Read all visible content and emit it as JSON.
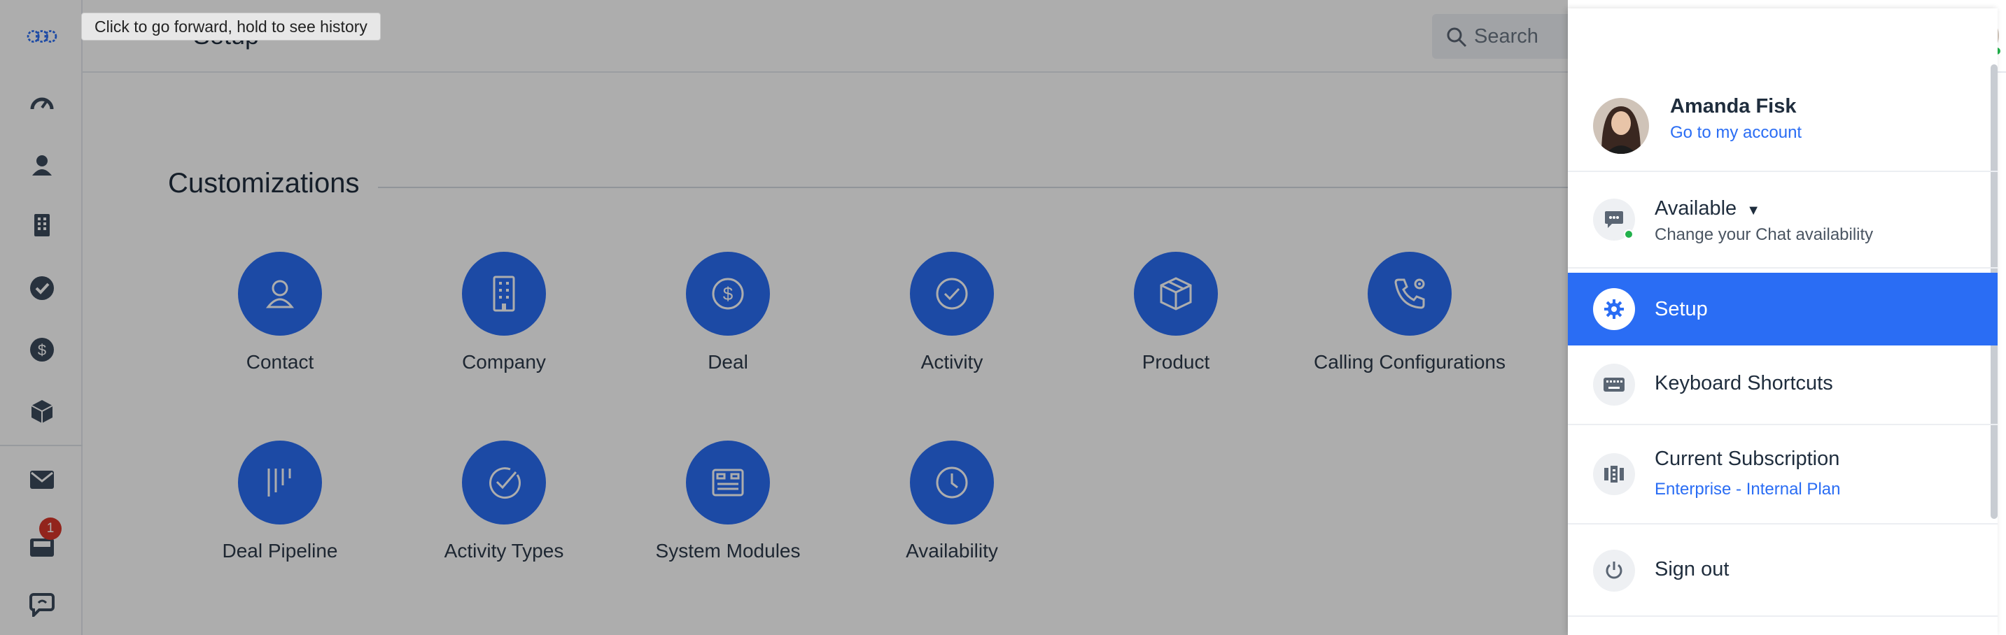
{
  "tooltip": "Click to go forward, hold to see history",
  "header": {
    "title": "Setup",
    "search_placeholder": "Search"
  },
  "sidebar": {
    "notification_count": "1"
  },
  "customizations": {
    "title": "Customizations",
    "row1": [
      "Contact",
      "Company",
      "Deal",
      "Activity",
      "Product",
      "Calling Configurations"
    ],
    "row2": [
      "Deal Pipeline",
      "Activity Types",
      "System Modules",
      "Availability"
    ]
  },
  "menu": {
    "user_name": "Amanda Fisk",
    "account_link": "Go to my account",
    "availability": {
      "status": "Available",
      "caption": "Change your Chat availability"
    },
    "setup": "Setup",
    "shortcuts": "Keyboard Shortcuts",
    "subscription": {
      "title": "Current Subscription",
      "plan": "Enterprise - Internal Plan"
    },
    "sign_out": "Sign out"
  },
  "colors": {
    "accent": "#2a6df4",
    "online": "#22b14c",
    "badge": "#d8352a",
    "arrow": "#e8402a"
  },
  "icons": {
    "sidebar": [
      "logo-icon",
      "dashboard-icon",
      "contact-icon",
      "company-icon",
      "activity-icon",
      "deal-icon",
      "product-icon",
      "mail-icon",
      "inbox-icon",
      "chat-icon"
    ],
    "topbar": [
      "add-icon",
      "phone-icon",
      "bell-icon",
      "help-icon"
    ]
  }
}
